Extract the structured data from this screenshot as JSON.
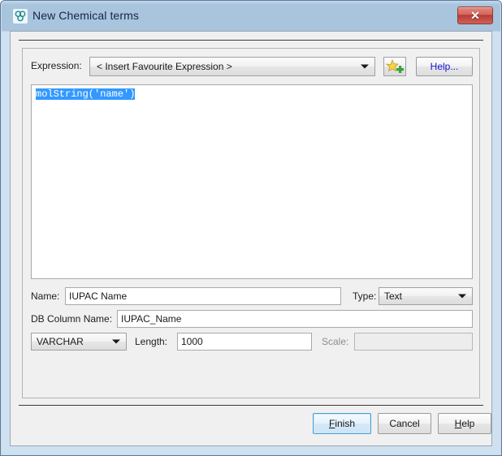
{
  "window": {
    "title": "New Chemical terms",
    "icon": "molecule-icon",
    "close_label": "✕",
    "border_color": "#5c7a99",
    "titlebar_color": "#a9c4dd"
  },
  "expression_row": {
    "label": "Expression:",
    "combo_value": "< Insert Favourite Expression >",
    "combo_options": [
      "< Insert Favourite Expression >"
    ],
    "favourite_button_icon": "add-favourite-star-icon",
    "help_label": "Help...",
    "help_color": "#1111cc"
  },
  "editor": {
    "text": "molString('name')",
    "selected": true,
    "selection_color": "#3399ff"
  },
  "fields": {
    "name": {
      "label": "Name:",
      "value": "IUPAC Name",
      "placeholder": ""
    },
    "type": {
      "label": "Type:",
      "value": "Text",
      "options": [
        "Text"
      ]
    },
    "db_column": {
      "label": "DB Column Name:",
      "value": "IUPAC_Name",
      "placeholder": ""
    },
    "sql_type": {
      "value": "VARCHAR",
      "options": [
        "VARCHAR"
      ]
    },
    "length": {
      "label": "Length:",
      "value": "1000",
      "placeholder": ""
    },
    "scale": {
      "label": "Scale:",
      "value": "",
      "placeholder": "",
      "disabled": true
    }
  },
  "buttons": {
    "finish": "Finish",
    "finish_mnemonic": "F",
    "cancel": "Cancel",
    "help": "Help",
    "help_mnemonic": "H"
  }
}
